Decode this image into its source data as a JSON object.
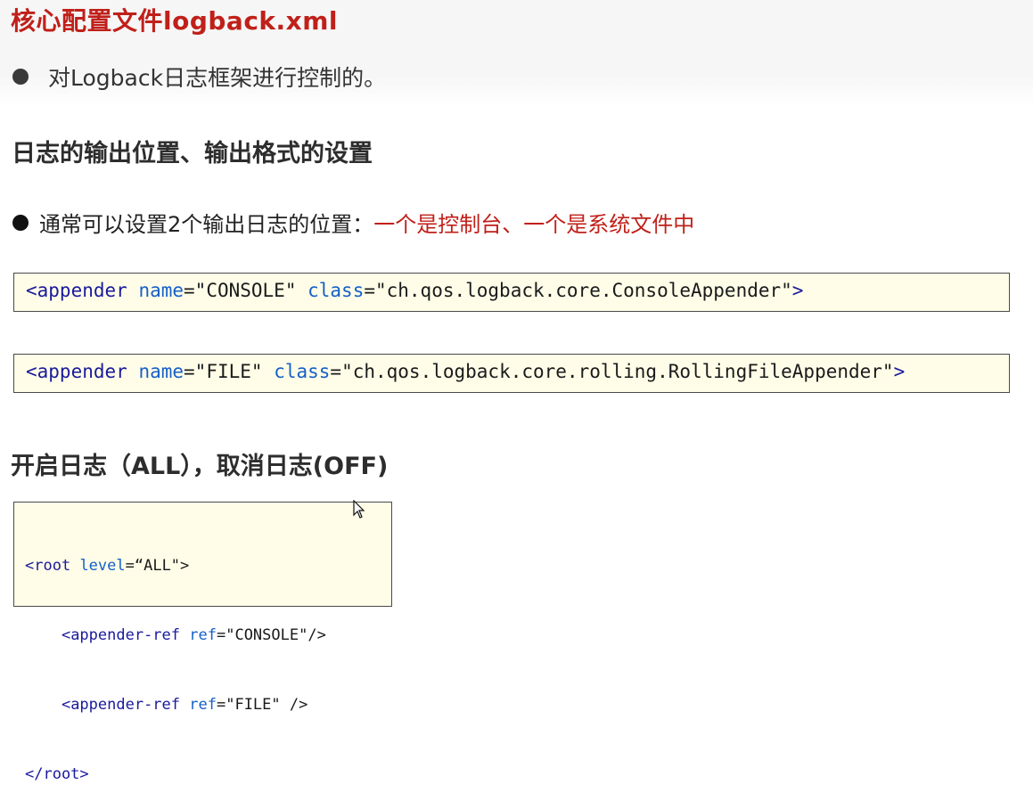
{
  "slide": {
    "title": "核心配置文件logback.xml",
    "intro": "对Logback日志框架进行控制的。",
    "section1_heading": "日志的输出位置、输出格式的设置",
    "locations_text": "通常可以设置2个输出日志的位置：",
    "locations_highlight": "一个是控制台、一个是系统文件中",
    "section2_heading": "开启日志（ALL），取消日志(OFF)"
  },
  "code1": {
    "open": "<appender",
    "attr1": "name",
    "val1": "=\"CONSOLE\"",
    "attr2": "class",
    "val2": "=\"ch.qos.logback.core.ConsoleAppender\"",
    "close": ">"
  },
  "code2": {
    "open": "<appender",
    "attr1": "name",
    "val1": "=\"FILE\"",
    "attr2": "class",
    "val2": "=\"ch.qos.logback.core.rolling.RollingFileAppender\"",
    "close": ">"
  },
  "code3": {
    "line1_tag": "<root",
    "line1_attr": "level",
    "line1_val": "=“ALL\">",
    "line2_tag": "<appender-ref",
    "line2_attr": "ref",
    "line2_val": "=\"CONSOLE\"/>",
    "line3_tag": "<appender-ref",
    "line3_attr": "ref",
    "line3_val": "=\"FILE\" />",
    "line4_tag": "</root>"
  },
  "colors": {
    "title_red": "#c0201a",
    "code_bg": "#fffde8",
    "xml_tag": "#1a1a9c",
    "xml_attr": "#1560c8"
  }
}
